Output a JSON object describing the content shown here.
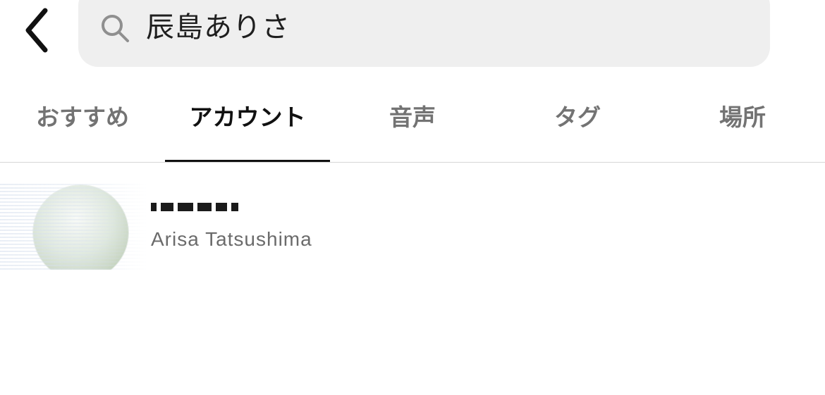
{
  "header": {
    "back_icon": "chevron-left-icon",
    "search": {
      "icon": "search-icon",
      "query": "辰島ありさ"
    }
  },
  "tabs": [
    {
      "label": "おすすめ",
      "active": false
    },
    {
      "label": "アカウント",
      "active": true
    },
    {
      "label": "音声",
      "active": false
    },
    {
      "label": "タグ",
      "active": false
    },
    {
      "label": "場所",
      "active": false
    }
  ],
  "results": [
    {
      "username": "",
      "full_name": "Arisa Tatsushima"
    }
  ]
}
